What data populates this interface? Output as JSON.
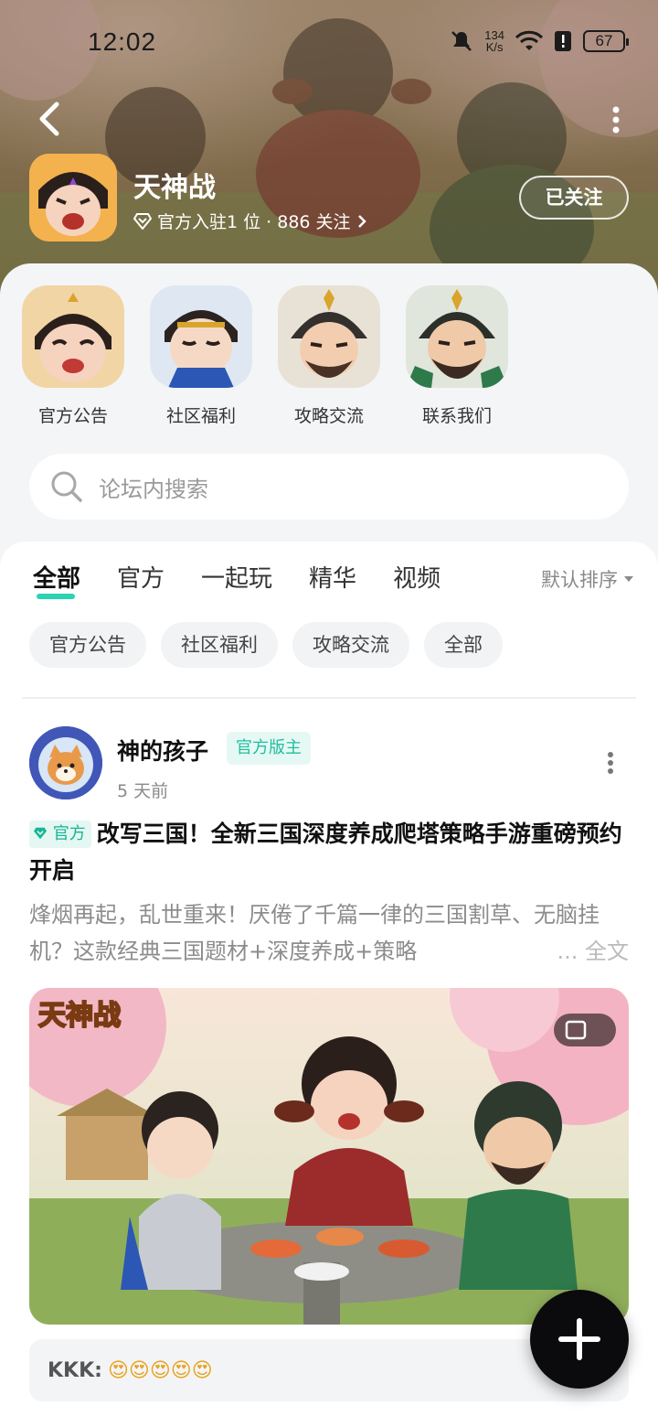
{
  "status_bar": {
    "time": "12:02",
    "net_speed_value": "134",
    "net_speed_unit": "K/s",
    "battery": "67"
  },
  "header": {
    "forum_name": "天神战",
    "meta": "官方入驻1 位 · 886 关注",
    "follow_label": "已关注"
  },
  "channels": [
    {
      "label": "官方公告"
    },
    {
      "label": "社区福利"
    },
    {
      "label": "攻略交流"
    },
    {
      "label": "联系我们"
    }
  ],
  "search": {
    "placeholder": "论坛内搜索"
  },
  "tabs": [
    {
      "label": "全部",
      "active": true
    },
    {
      "label": "官方"
    },
    {
      "label": "一起玩"
    },
    {
      "label": "精华"
    },
    {
      "label": "视频"
    }
  ],
  "sort_label": "默认排序",
  "filters": [
    {
      "label": "官方公告"
    },
    {
      "label": "社区福利"
    },
    {
      "label": "攻略交流"
    },
    {
      "label": "全部"
    }
  ],
  "post": {
    "author": "神的孩子",
    "role": "官方版主",
    "time": "5 天前",
    "official_tag": "官方",
    "title": "改写三国！全新三国深度养成爬塔策略手游重磅预约开启",
    "body": "烽烟再起，乱世重来！厌倦了千篇一律的三国割草、无脑挂机？这款经典三国题材+深度养成+策略",
    "read_more": "... 全文",
    "image_logo_text": "天神战",
    "comment_user": "KKK:",
    "comment_text": "😍😍😍😍😍"
  },
  "colors": {
    "accent": "#2bd2b3",
    "badge_bg": "#e6f8f4",
    "badge_text": "#1fbf9f"
  }
}
